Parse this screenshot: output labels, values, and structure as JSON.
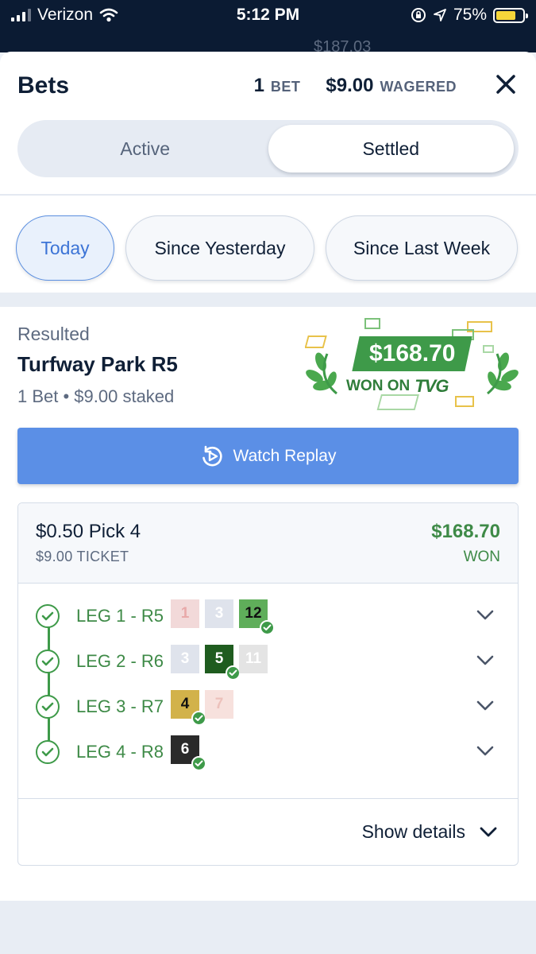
{
  "status_bar": {
    "carrier": "Verizon",
    "time": "5:12 PM",
    "battery": "75%"
  },
  "background_balance": "$187.03",
  "header": {
    "title": "Bets",
    "bet_count": "1",
    "bet_label": "BET",
    "wagered_amount": "$9.00",
    "wagered_label": "WAGERED"
  },
  "tabs": {
    "active": "Active",
    "settled": "Settled",
    "selected": "Settled"
  },
  "filters": {
    "today": "Today",
    "since_yesterday": "Since Yesterday",
    "since_last_week": "Since Last Week",
    "selected": "Today"
  },
  "race": {
    "status": "Resulted",
    "name": "Turfway Park R5",
    "meta": "1 Bet • $9.00 staked"
  },
  "win_badge": {
    "amount": "$168.70",
    "won_on": "WON ON",
    "brand": "TVG"
  },
  "replay_button": "Watch Replay",
  "ticket": {
    "bet_type": "$0.50 Pick 4",
    "ticket_cost": "$9.00 TICKET",
    "payout": "$168.70",
    "status": "WON",
    "legs": [
      {
        "label": "LEG 1 - R5",
        "runners": [
          {
            "num": "1",
            "bg": "#f2d9d9",
            "fg": "#e8a9a9",
            "winner": false
          },
          {
            "num": "3",
            "bg": "#dfe3ec",
            "fg": "#ffffff",
            "winner": false
          },
          {
            "num": "12",
            "bg": "#5fae5a",
            "fg": "#111111",
            "winner": true
          }
        ]
      },
      {
        "label": "LEG 2 - R6",
        "runners": [
          {
            "num": "3",
            "bg": "#dfe3ec",
            "fg": "#ffffff",
            "winner": false
          },
          {
            "num": "5",
            "bg": "#1f5c1f",
            "fg": "#ffffff",
            "winner": true
          },
          {
            "num": "11",
            "bg": "#e4e4e4",
            "fg": "#ffffff",
            "winner": false
          }
        ]
      },
      {
        "label": "LEG 3 - R7",
        "runners": [
          {
            "num": "4",
            "bg": "#d2b24a",
            "fg": "#111111",
            "winner": true
          },
          {
            "num": "7",
            "bg": "#f7e1dd",
            "fg": "#ecc1bb",
            "winner": false
          }
        ]
      },
      {
        "label": "LEG 4 - R8",
        "runners": [
          {
            "num": "6",
            "bg": "#2a2a2a",
            "fg": "#ffffff",
            "winner": true
          }
        ]
      }
    ],
    "show_details": "Show details"
  },
  "colors": {
    "accent_blue": "#5b8fe6",
    "win_green": "#3e9a49",
    "navy": "#0f1f36"
  },
  "icons": {
    "close": "close-icon",
    "replay": "replay-icon",
    "check": "check-circle-icon",
    "chevron": "chevron-down-icon"
  }
}
